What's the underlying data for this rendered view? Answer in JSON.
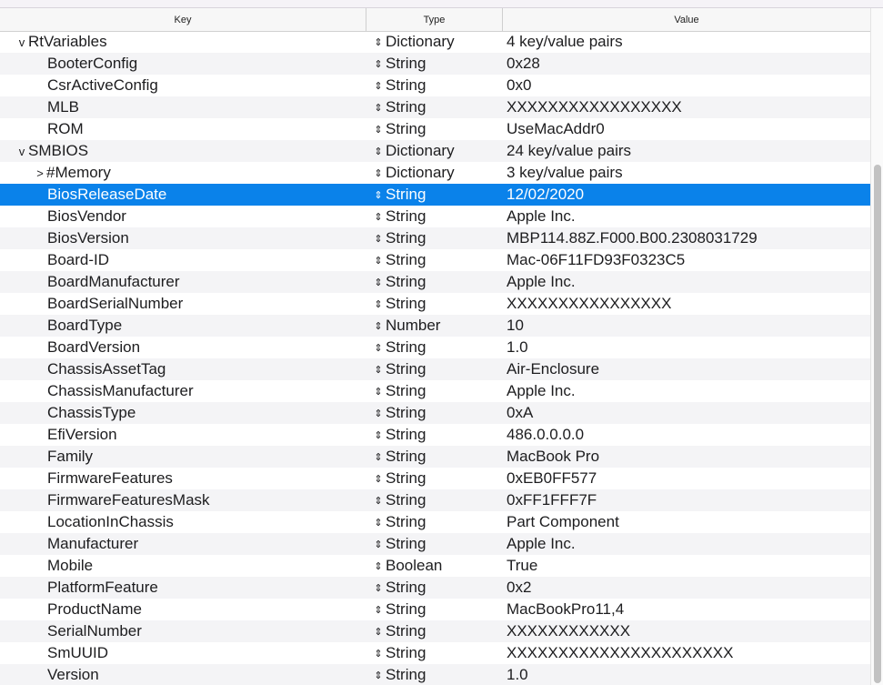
{
  "columns": {
    "key": "Key",
    "type": "Type",
    "value": "Value"
  },
  "rows": [
    {
      "key": "RtVariables",
      "type": "Dictionary",
      "value": "4 key/value pairs",
      "level": 0,
      "disclosure": "v"
    },
    {
      "key": "BooterConfig",
      "type": "String",
      "value": "0x28",
      "level": 1
    },
    {
      "key": "CsrActiveConfig",
      "type": "String",
      "value": "0x0",
      "level": 1
    },
    {
      "key": "MLB",
      "type": "String",
      "value": "XXXXXXXXXXXXXXXXX",
      "level": 1
    },
    {
      "key": "ROM",
      "type": "String",
      "value": "UseMacAddr0",
      "level": 1
    },
    {
      "key": "SMBIOS",
      "type": "Dictionary",
      "value": "24 key/value pairs",
      "level": 0,
      "disclosure": "v"
    },
    {
      "key": "#Memory",
      "type": "Dictionary",
      "value": "3 key/value pairs",
      "level": 1,
      "disclosure": ">"
    },
    {
      "key": "BiosReleaseDate",
      "type": "String",
      "value": "12/02/2020",
      "level": 1,
      "selected": true
    },
    {
      "key": "BiosVendor",
      "type": "String",
      "value": "Apple Inc.",
      "level": 1
    },
    {
      "key": "BiosVersion",
      "type": "String",
      "value": "MBP114.88Z.F000.B00.2308031729",
      "level": 1
    },
    {
      "key": "Board-ID",
      "type": "String",
      "value": "Mac-06F11FD93F0323C5",
      "level": 1
    },
    {
      "key": "BoardManufacturer",
      "type": "String",
      "value": "Apple Inc.",
      "level": 1
    },
    {
      "key": "BoardSerialNumber",
      "type": "String",
      "value": "XXXXXXXXXXXXXXXX",
      "level": 1
    },
    {
      "key": "BoardType",
      "type": "Number",
      "value": "10",
      "level": 1
    },
    {
      "key": "BoardVersion",
      "type": "String",
      "value": "1.0",
      "level": 1
    },
    {
      "key": "ChassisAssetTag",
      "type": "String",
      "value": "Air-Enclosure",
      "level": 1
    },
    {
      "key": "ChassisManufacturer",
      "type": "String",
      "value": "Apple Inc.",
      "level": 1
    },
    {
      "key": "ChassisType",
      "type": "String",
      "value": "0xA",
      "level": 1
    },
    {
      "key": "EfiVersion",
      "type": "String",
      "value": "486.0.0.0.0",
      "level": 1
    },
    {
      "key": "Family",
      "type": "String",
      "value": "MacBook Pro",
      "level": 1
    },
    {
      "key": "FirmwareFeatures",
      "type": "String",
      "value": "0xEB0FF577",
      "level": 1
    },
    {
      "key": "FirmwareFeaturesMask",
      "type": "String",
      "value": "0xFF1FFF7F",
      "level": 1
    },
    {
      "key": "LocationInChassis",
      "type": "String",
      "value": "Part Component",
      "level": 1
    },
    {
      "key": "Manufacturer",
      "type": "String",
      "value": "Apple Inc.",
      "level": 1
    },
    {
      "key": "Mobile",
      "type": "Boolean",
      "value": "True",
      "level": 1
    },
    {
      "key": "PlatformFeature",
      "type": "String",
      "value": "0x2",
      "level": 1
    },
    {
      "key": "ProductName",
      "type": "String",
      "value": "MacBookPro11,4",
      "level": 1
    },
    {
      "key": "SerialNumber",
      "type": "String",
      "value": "XXXXXXXXXXXX",
      "level": 1
    },
    {
      "key": "SmUUID",
      "type": "String",
      "value": "XXXXXXXXXXXXXXXXXXXXXX",
      "level": 1
    },
    {
      "key": "Version",
      "type": "String",
      "value": "1.0",
      "level": 1
    }
  ],
  "stepper_glyph": "⇕",
  "icons": {
    "expanded": "chevron-down-icon",
    "collapsed": "chevron-right-icon",
    "type_stepper": "up-down-arrows-icon"
  },
  "colors": {
    "selection": "#0a82ea",
    "alt_row": "#f4f4f6"
  }
}
